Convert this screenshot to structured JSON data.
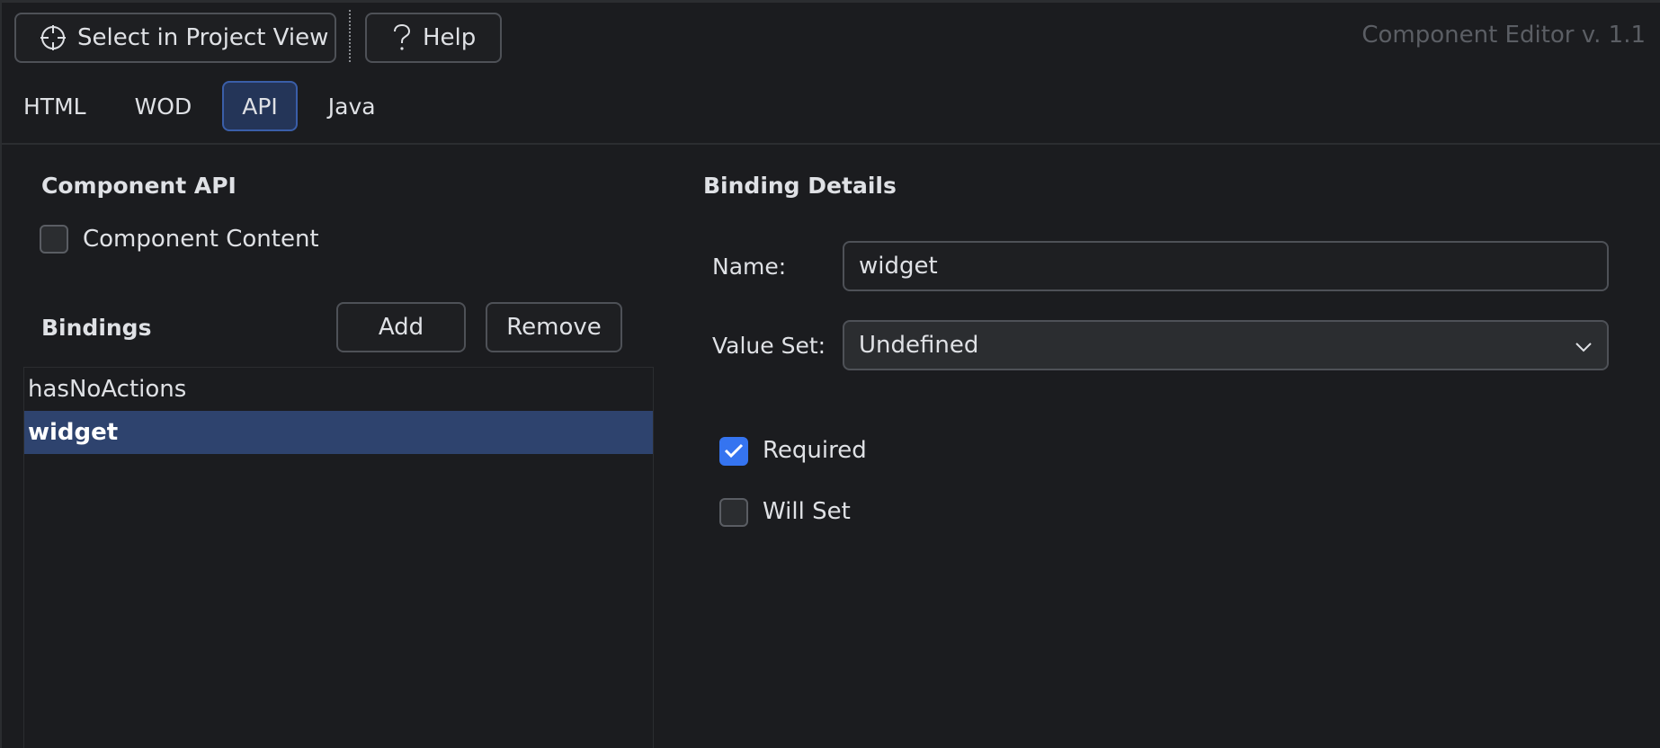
{
  "toolbar": {
    "select_label": "Select in Project View",
    "help_label": "Help",
    "select_icon": "crosshair-icon",
    "help_icon": "question-icon",
    "version": "Component Editor v. 1.1"
  },
  "tabs": [
    {
      "label": "HTML",
      "active": false
    },
    {
      "label": "WOD",
      "active": false
    },
    {
      "label": "API",
      "active": true
    },
    {
      "label": "Java",
      "active": false
    }
  ],
  "component_api": {
    "title": "Component API",
    "content_label": "Component Content",
    "content_checked": false
  },
  "bindings": {
    "title": "Bindings",
    "add_label": "Add",
    "remove_label": "Remove",
    "items": [
      {
        "name": "hasNoActions",
        "selected": false
      },
      {
        "name": "widget",
        "selected": true
      }
    ]
  },
  "details": {
    "title": "Binding Details",
    "name_label": "Name:",
    "name_value": "widget",
    "value_set_label": "Value Set:",
    "value_set_value": "Undefined",
    "required_label": "Required",
    "required_checked": true,
    "will_set_label": "Will Set",
    "will_set_checked": false
  },
  "colors": {
    "background": "#1b1c1f",
    "accent": "#3574f0",
    "selection": "#2e436e",
    "tab_active": "#243558"
  }
}
